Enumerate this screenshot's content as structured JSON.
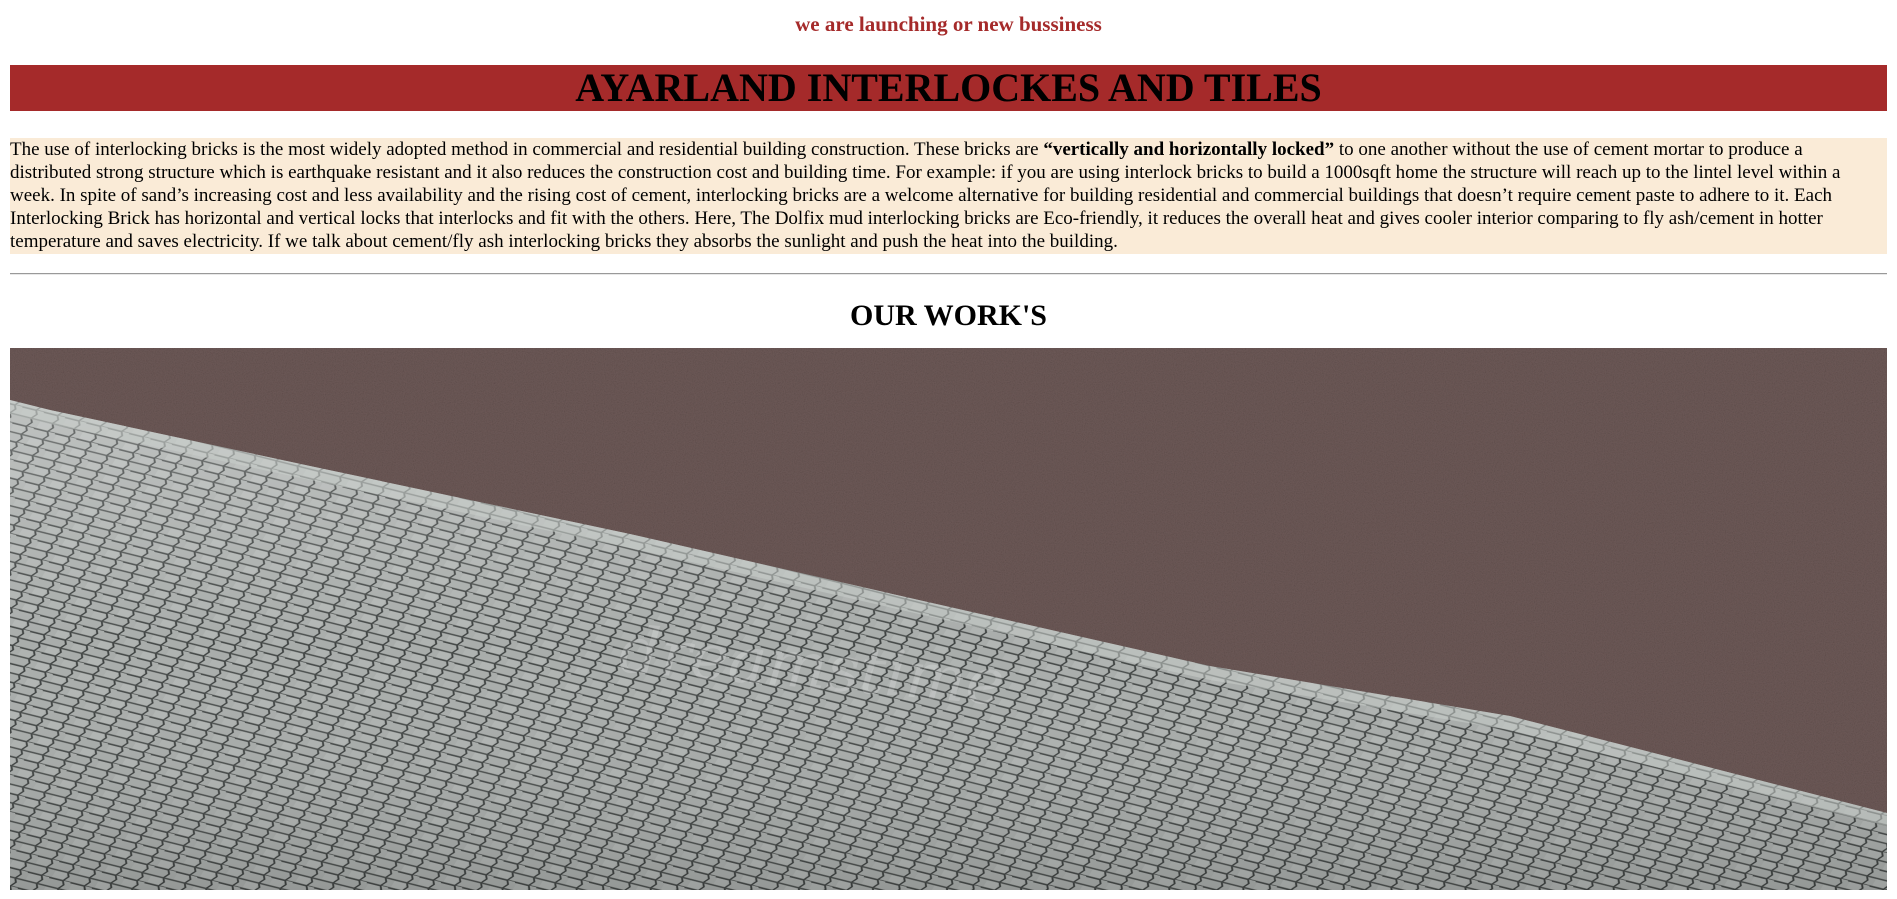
{
  "header": {
    "tagline": "we are launching or new bussiness",
    "title": "AYARLAND INTERLOCKES AND TILES"
  },
  "intro": {
    "text_before": "The use of interlocking bricks is the most widely adopted method in commercial and residential building construction. These bricks are ",
    "bold": "“vertically and horizontally locked”",
    "text_after": " to one another without the use of cement mortar to produce a distributed strong structure which is earthquake resistant and it also reduces the construction cost and building time. For example: if you are using interlock bricks to build a 1000sqft home the structure will reach up to the lintel level within a week. In spite of sand’s increasing cost and less availability and the rising cost of cement, interlocking bricks are a welcome alternative for building residential and commercial buildings that doesn’t require cement paste to adhere to it. Each Interlocking Brick has horizontal and vertical locks that interlocks and fit with the others. Here, The Dolfix mud interlocking bricks are Eco-friendly, it reduces the overall heat and gives cooler interior comparing to fly ash/cement in hotter temperature and saves electricity. If we talk about cement/fly ash interlocking bricks they absorbs the sunlight and push the heat into the building."
  },
  "works": {
    "title": "OUR WORK'S",
    "image_watermark": "dreamstime"
  },
  "colors": {
    "brand_red": "#a52a2a",
    "intro_bg": "#faebd7",
    "asphalt": "#6e5a58",
    "paver": "#a9adab"
  }
}
